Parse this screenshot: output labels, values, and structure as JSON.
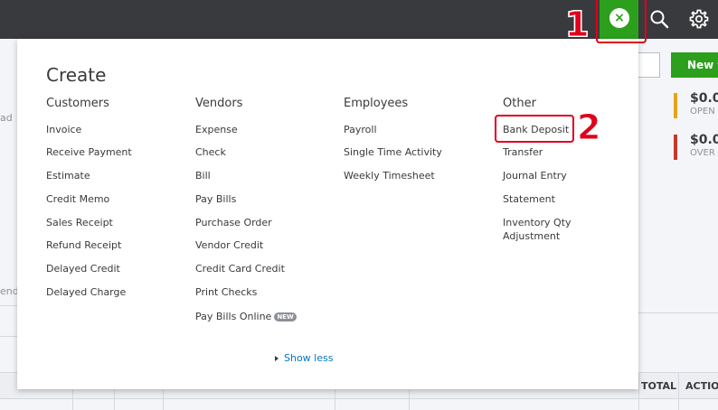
{
  "header": {
    "create_close_symbol": "×"
  },
  "background": {
    "new_button_label": "New t",
    "stats": [
      {
        "amount": "$0.0",
        "label": "OPEN",
        "color": "#e7a31b"
      },
      {
        "amount": "$0.0",
        "label": "OVER",
        "color": "#c9372c"
      }
    ],
    "left_fragments": [
      "ad",
      "end"
    ],
    "table_headers": [
      "TOTAL",
      "ACTIO"
    ]
  },
  "create_panel": {
    "title": "Create",
    "columns": [
      {
        "heading": "Customers",
        "items": [
          "Invoice",
          "Receive Payment",
          "Estimate",
          "Credit Memo",
          "Sales Receipt",
          "Refund Receipt",
          "Delayed Credit",
          "Delayed Charge"
        ]
      },
      {
        "heading": "Vendors",
        "items": [
          "Expense",
          "Check",
          "Bill",
          "Pay Bills",
          "Purchase Order",
          "Vendor Credit",
          "Credit Card Credit",
          "Print Checks",
          "Pay Bills Online"
        ],
        "badge": "NEW"
      },
      {
        "heading": "Employees",
        "items": [
          "Payroll",
          "Single Time Activity",
          "Weekly Timesheet"
        ]
      },
      {
        "heading": "Other",
        "items": [
          "Bank Deposit",
          "Transfer",
          "Journal Entry",
          "Statement",
          "Inventory Qty",
          "Adjustment"
        ]
      }
    ],
    "show_less": "Show less"
  },
  "annotations": {
    "step1": "1",
    "step2": "2",
    "color": "#e0001b"
  }
}
